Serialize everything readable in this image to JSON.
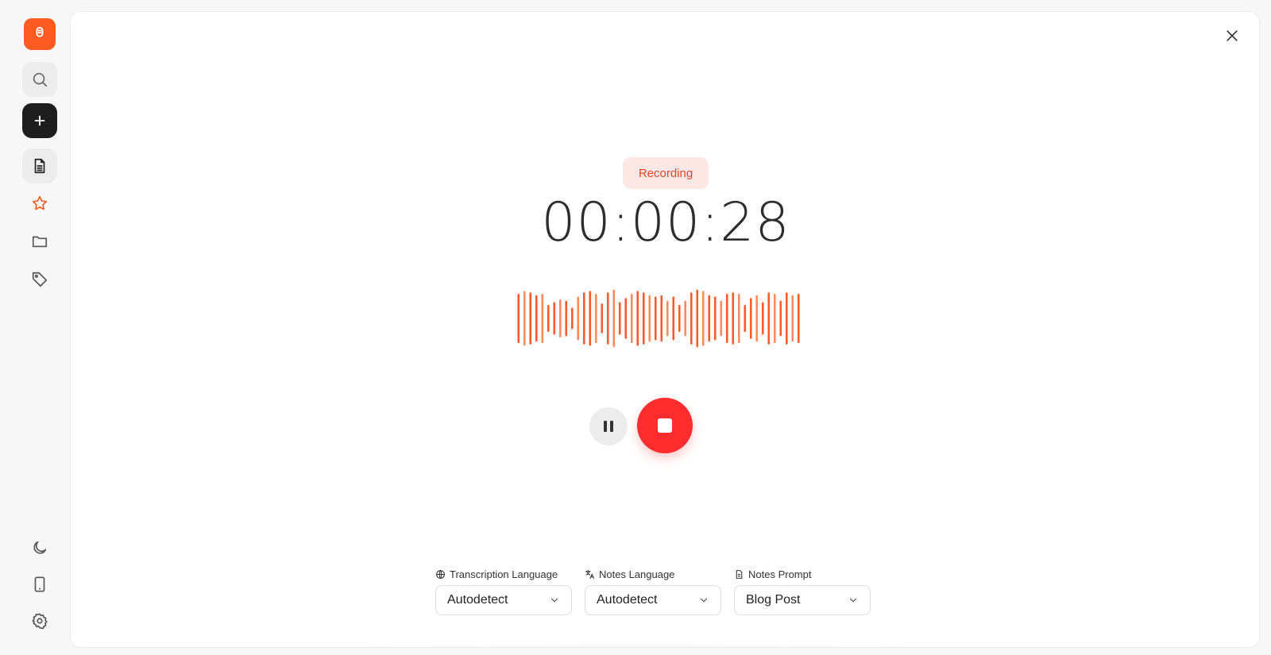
{
  "sidebar": {
    "items": [
      {
        "name": "logo",
        "icon": "microphone-icon"
      },
      {
        "name": "search",
        "icon": "search-icon"
      },
      {
        "name": "new",
        "icon": "plus-icon"
      },
      {
        "name": "notes",
        "icon": "document-icon"
      },
      {
        "name": "favorites",
        "icon": "star-icon"
      },
      {
        "name": "folders",
        "icon": "folder-icon"
      },
      {
        "name": "tags",
        "icon": "tag-icon"
      },
      {
        "name": "theme",
        "icon": "moon-icon"
      },
      {
        "name": "mobile",
        "icon": "phone-icon"
      },
      {
        "name": "settings",
        "icon": "gear-icon"
      }
    ]
  },
  "recorder": {
    "status": "Recording",
    "elapsed": "00:00:28",
    "controls": {
      "pause_icon": "pause-icon",
      "stop_icon": "stop-icon"
    }
  },
  "options": {
    "transcription_language": {
      "label": "Transcription Language",
      "value": "Autodetect",
      "icon": "globe-icon"
    },
    "notes_language": {
      "label": "Notes Language",
      "value": "Autodetect",
      "icon": "translate-icon"
    },
    "notes_prompt": {
      "label": "Notes Prompt",
      "value": "Blog Post",
      "icon": "document-icon"
    }
  },
  "colors": {
    "accent": "#ff5a1f",
    "stop": "#ff2d2d",
    "waveform": "#ff5a2a",
    "badge_bg": "#fde7e4",
    "badge_text": "#e2452c"
  }
}
